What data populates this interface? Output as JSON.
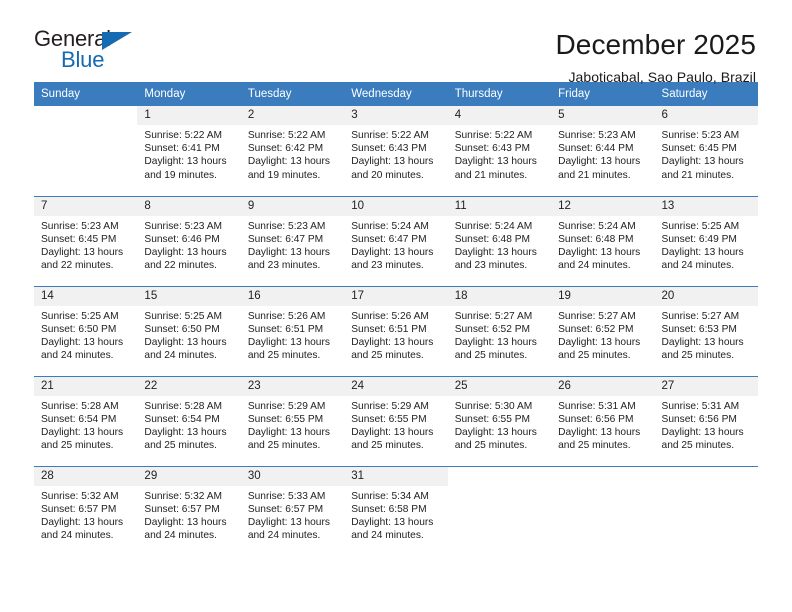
{
  "logo": {
    "word_top": "General",
    "word_bottom": "Blue",
    "triangle_icon": "blue-triangle-icon",
    "accent_color": "#156bb1"
  },
  "header": {
    "title": "December 2025",
    "subtitle": "Jaboticabal, Sao Paulo, Brazil"
  },
  "theme": {
    "header_bg": "#3a7cbe",
    "header_text": "#ffffff",
    "daynum_bg": "#f1f1f1",
    "body_text": "#222222"
  },
  "weekdays": [
    "Sunday",
    "Monday",
    "Tuesday",
    "Wednesday",
    "Thursday",
    "Friday",
    "Saturday"
  ],
  "weeks": [
    [
      {
        "day": "",
        "sunrise": "",
        "sunset": "",
        "daylight": "",
        "empty": true
      },
      {
        "day": "1",
        "sunrise": "Sunrise: 5:22 AM",
        "sunset": "Sunset: 6:41 PM",
        "daylight": "Daylight: 13 hours and 19 minutes."
      },
      {
        "day": "2",
        "sunrise": "Sunrise: 5:22 AM",
        "sunset": "Sunset: 6:42 PM",
        "daylight": "Daylight: 13 hours and 19 minutes."
      },
      {
        "day": "3",
        "sunrise": "Sunrise: 5:22 AM",
        "sunset": "Sunset: 6:43 PM",
        "daylight": "Daylight: 13 hours and 20 minutes."
      },
      {
        "day": "4",
        "sunrise": "Sunrise: 5:22 AM",
        "sunset": "Sunset: 6:43 PM",
        "daylight": "Daylight: 13 hours and 21 minutes."
      },
      {
        "day": "5",
        "sunrise": "Sunrise: 5:23 AM",
        "sunset": "Sunset: 6:44 PM",
        "daylight": "Daylight: 13 hours and 21 minutes."
      },
      {
        "day": "6",
        "sunrise": "Sunrise: 5:23 AM",
        "sunset": "Sunset: 6:45 PM",
        "daylight": "Daylight: 13 hours and 21 minutes."
      }
    ],
    [
      {
        "day": "7",
        "sunrise": "Sunrise: 5:23 AM",
        "sunset": "Sunset: 6:45 PM",
        "daylight": "Daylight: 13 hours and 22 minutes."
      },
      {
        "day": "8",
        "sunrise": "Sunrise: 5:23 AM",
        "sunset": "Sunset: 6:46 PM",
        "daylight": "Daylight: 13 hours and 22 minutes."
      },
      {
        "day": "9",
        "sunrise": "Sunrise: 5:23 AM",
        "sunset": "Sunset: 6:47 PM",
        "daylight": "Daylight: 13 hours and 23 minutes."
      },
      {
        "day": "10",
        "sunrise": "Sunrise: 5:24 AM",
        "sunset": "Sunset: 6:47 PM",
        "daylight": "Daylight: 13 hours and 23 minutes."
      },
      {
        "day": "11",
        "sunrise": "Sunrise: 5:24 AM",
        "sunset": "Sunset: 6:48 PM",
        "daylight": "Daylight: 13 hours and 23 minutes."
      },
      {
        "day": "12",
        "sunrise": "Sunrise: 5:24 AM",
        "sunset": "Sunset: 6:48 PM",
        "daylight": "Daylight: 13 hours and 24 minutes."
      },
      {
        "day": "13",
        "sunrise": "Sunrise: 5:25 AM",
        "sunset": "Sunset: 6:49 PM",
        "daylight": "Daylight: 13 hours and 24 minutes."
      }
    ],
    [
      {
        "day": "14",
        "sunrise": "Sunrise: 5:25 AM",
        "sunset": "Sunset: 6:50 PM",
        "daylight": "Daylight: 13 hours and 24 minutes."
      },
      {
        "day": "15",
        "sunrise": "Sunrise: 5:25 AM",
        "sunset": "Sunset: 6:50 PM",
        "daylight": "Daylight: 13 hours and 24 minutes."
      },
      {
        "day": "16",
        "sunrise": "Sunrise: 5:26 AM",
        "sunset": "Sunset: 6:51 PM",
        "daylight": "Daylight: 13 hours and 25 minutes."
      },
      {
        "day": "17",
        "sunrise": "Sunrise: 5:26 AM",
        "sunset": "Sunset: 6:51 PM",
        "daylight": "Daylight: 13 hours and 25 minutes."
      },
      {
        "day": "18",
        "sunrise": "Sunrise: 5:27 AM",
        "sunset": "Sunset: 6:52 PM",
        "daylight": "Daylight: 13 hours and 25 minutes."
      },
      {
        "day": "19",
        "sunrise": "Sunrise: 5:27 AM",
        "sunset": "Sunset: 6:52 PM",
        "daylight": "Daylight: 13 hours and 25 minutes."
      },
      {
        "day": "20",
        "sunrise": "Sunrise: 5:27 AM",
        "sunset": "Sunset: 6:53 PM",
        "daylight": "Daylight: 13 hours and 25 minutes."
      }
    ],
    [
      {
        "day": "21",
        "sunrise": "Sunrise: 5:28 AM",
        "sunset": "Sunset: 6:54 PM",
        "daylight": "Daylight: 13 hours and 25 minutes."
      },
      {
        "day": "22",
        "sunrise": "Sunrise: 5:28 AM",
        "sunset": "Sunset: 6:54 PM",
        "daylight": "Daylight: 13 hours and 25 minutes."
      },
      {
        "day": "23",
        "sunrise": "Sunrise: 5:29 AM",
        "sunset": "Sunset: 6:55 PM",
        "daylight": "Daylight: 13 hours and 25 minutes."
      },
      {
        "day": "24",
        "sunrise": "Sunrise: 5:29 AM",
        "sunset": "Sunset: 6:55 PM",
        "daylight": "Daylight: 13 hours and 25 minutes."
      },
      {
        "day": "25",
        "sunrise": "Sunrise: 5:30 AM",
        "sunset": "Sunset: 6:55 PM",
        "daylight": "Daylight: 13 hours and 25 minutes."
      },
      {
        "day": "26",
        "sunrise": "Sunrise: 5:31 AM",
        "sunset": "Sunset: 6:56 PM",
        "daylight": "Daylight: 13 hours and 25 minutes."
      },
      {
        "day": "27",
        "sunrise": "Sunrise: 5:31 AM",
        "sunset": "Sunset: 6:56 PM",
        "daylight": "Daylight: 13 hours and 25 minutes."
      }
    ],
    [
      {
        "day": "28",
        "sunrise": "Sunrise: 5:32 AM",
        "sunset": "Sunset: 6:57 PM",
        "daylight": "Daylight: 13 hours and 24 minutes."
      },
      {
        "day": "29",
        "sunrise": "Sunrise: 5:32 AM",
        "sunset": "Sunset: 6:57 PM",
        "daylight": "Daylight: 13 hours and 24 minutes."
      },
      {
        "day": "30",
        "sunrise": "Sunrise: 5:33 AM",
        "sunset": "Sunset: 6:57 PM",
        "daylight": "Daylight: 13 hours and 24 minutes."
      },
      {
        "day": "31",
        "sunrise": "Sunrise: 5:34 AM",
        "sunset": "Sunset: 6:58 PM",
        "daylight": "Daylight: 13 hours and 24 minutes."
      },
      {
        "day": "",
        "sunrise": "",
        "sunset": "",
        "daylight": "",
        "empty": true
      },
      {
        "day": "",
        "sunrise": "",
        "sunset": "",
        "daylight": "",
        "empty": true
      },
      {
        "day": "",
        "sunrise": "",
        "sunset": "",
        "daylight": "",
        "empty": true
      }
    ]
  ]
}
